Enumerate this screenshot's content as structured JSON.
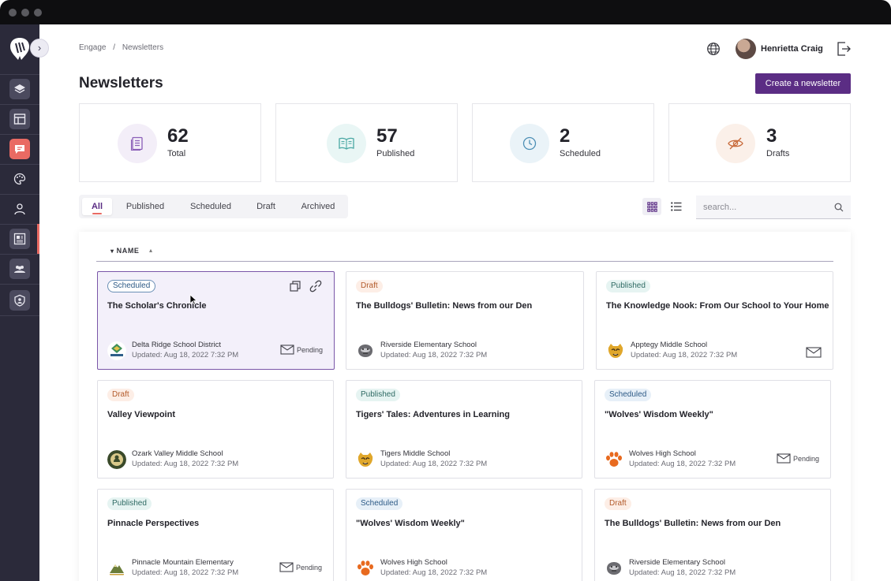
{
  "breadcrumb": [
    "Engage",
    "/",
    "Newsletters"
  ],
  "page": {
    "title": "Newsletters",
    "create_label": "Create a newsletter"
  },
  "user": {
    "name": "Henrietta Craig"
  },
  "stats": [
    {
      "value": "62",
      "label": "Total",
      "icon": "document-icon",
      "color": "#8b5fb8"
    },
    {
      "value": "57",
      "label": "Published",
      "icon": "book-icon",
      "color": "#4aa8a4"
    },
    {
      "value": "2",
      "label": "Scheduled",
      "icon": "clock-icon",
      "color": "#4d8fb5"
    },
    {
      "value": "3",
      "label": "Drafts",
      "icon": "eye-off-icon",
      "color": "#c86a3a"
    }
  ],
  "tabs": [
    "All",
    "Published",
    "Scheduled",
    "Draft",
    "Archived"
  ],
  "search": {
    "placeholder": "search..."
  },
  "sort": {
    "label": "NAME"
  },
  "cards": [
    {
      "status": "Scheduled",
      "title": "The Scholar's Chronicle",
      "school": "Delta Ridge School District",
      "updated": "Updated: Aug 18, 2022 7:32 PM",
      "mail": "Pending"
    },
    {
      "status": "Draft",
      "title": "The Bulldogs' Bulletin: News from our Den",
      "school": "Riverside Elementary School",
      "updated": "Updated: Aug 18, 2022 7:32 PM",
      "mail": ""
    },
    {
      "status": "Published",
      "title": "The Knowledge Nook: From Our School to Your Home",
      "school": "Apptegy Middle School",
      "updated": "Updated: Aug 18, 2022 7:32 PM",
      "mail": "icon"
    },
    {
      "status": "Draft",
      "title": "Valley Viewpoint",
      "school": "Ozark Valley Middle School",
      "updated": "Updated: Aug 18, 2022 7:32 PM",
      "mail": ""
    },
    {
      "status": "Published",
      "title": "Tigers' Tales: Adventures in Learning",
      "school": "Tigers Middle School",
      "updated": "Updated: Aug 18, 2022 7:32 PM",
      "mail": ""
    },
    {
      "status": "Scheduled",
      "title": "\"Wolves' Wisdom Weekly\"",
      "school": "Wolves High School",
      "updated": "Updated: Aug 18, 2022 7:32 PM",
      "mail": "Pending"
    },
    {
      "status": "Published",
      "title": "Pinnacle Perspectives",
      "school": "Pinnacle Mountain Elementary",
      "updated": "Updated: Aug 18, 2022 7:32 PM",
      "mail": "Pending"
    },
    {
      "status": "Scheduled",
      "title": "\"Wolves' Wisdom Weekly\"",
      "school": "Wolves High School",
      "updated": "Updated: Aug 18, 2022 7:32 PM",
      "mail": ""
    },
    {
      "status": "Draft",
      "title": "The Bulldogs' Bulletin: News from our Den",
      "school": "Riverside Elementary School",
      "updated": "Updated: Aug 18, 2022 7:32 PM",
      "mail": ""
    }
  ]
}
